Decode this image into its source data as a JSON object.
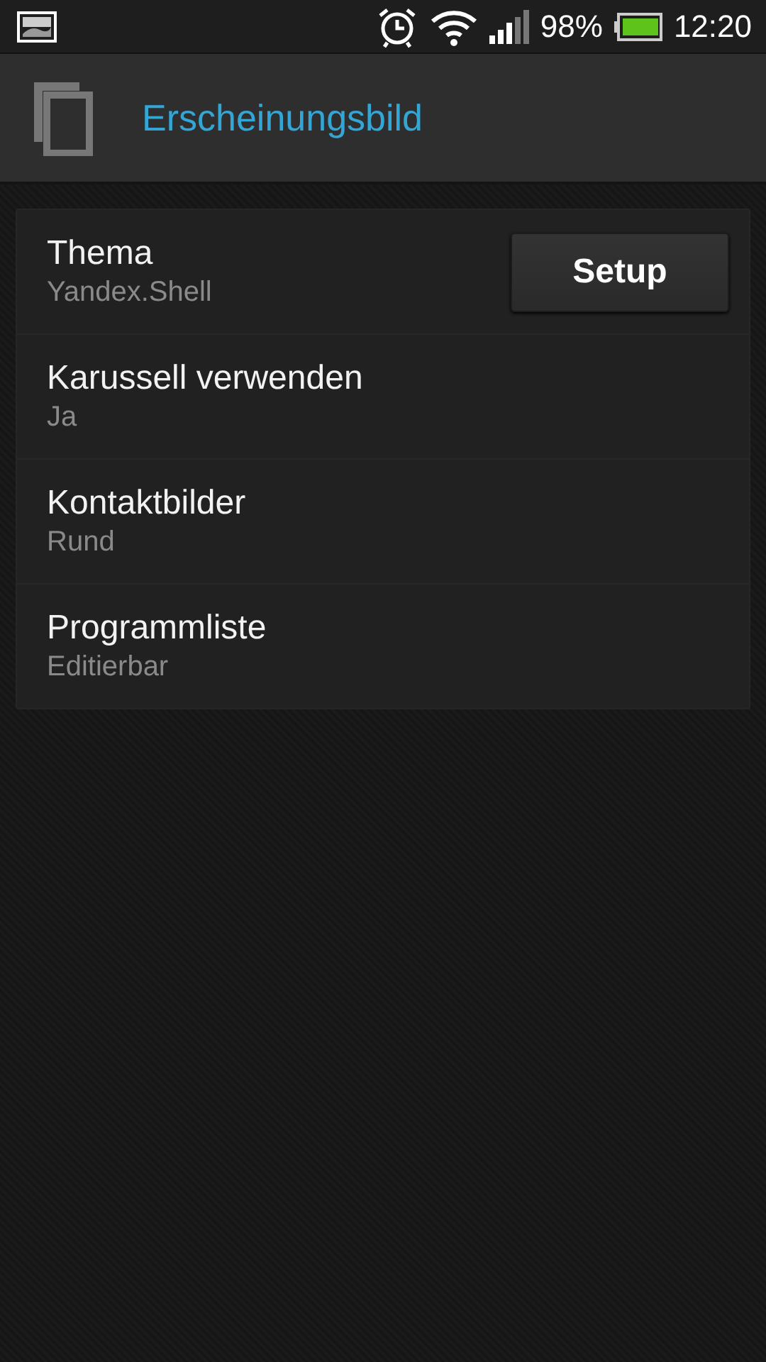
{
  "status_bar": {
    "battery": "98%",
    "time": "12:20"
  },
  "header": {
    "title": "Erscheinungsbild"
  },
  "settings": [
    {
      "title": "Thema",
      "value": "Yandex.Shell",
      "button": "Setup"
    },
    {
      "title": "Karussell verwenden",
      "value": "Ja"
    },
    {
      "title": "Kontaktbilder",
      "value": "Rund"
    },
    {
      "title": "Programmliste",
      "value": "Editierbar"
    }
  ]
}
